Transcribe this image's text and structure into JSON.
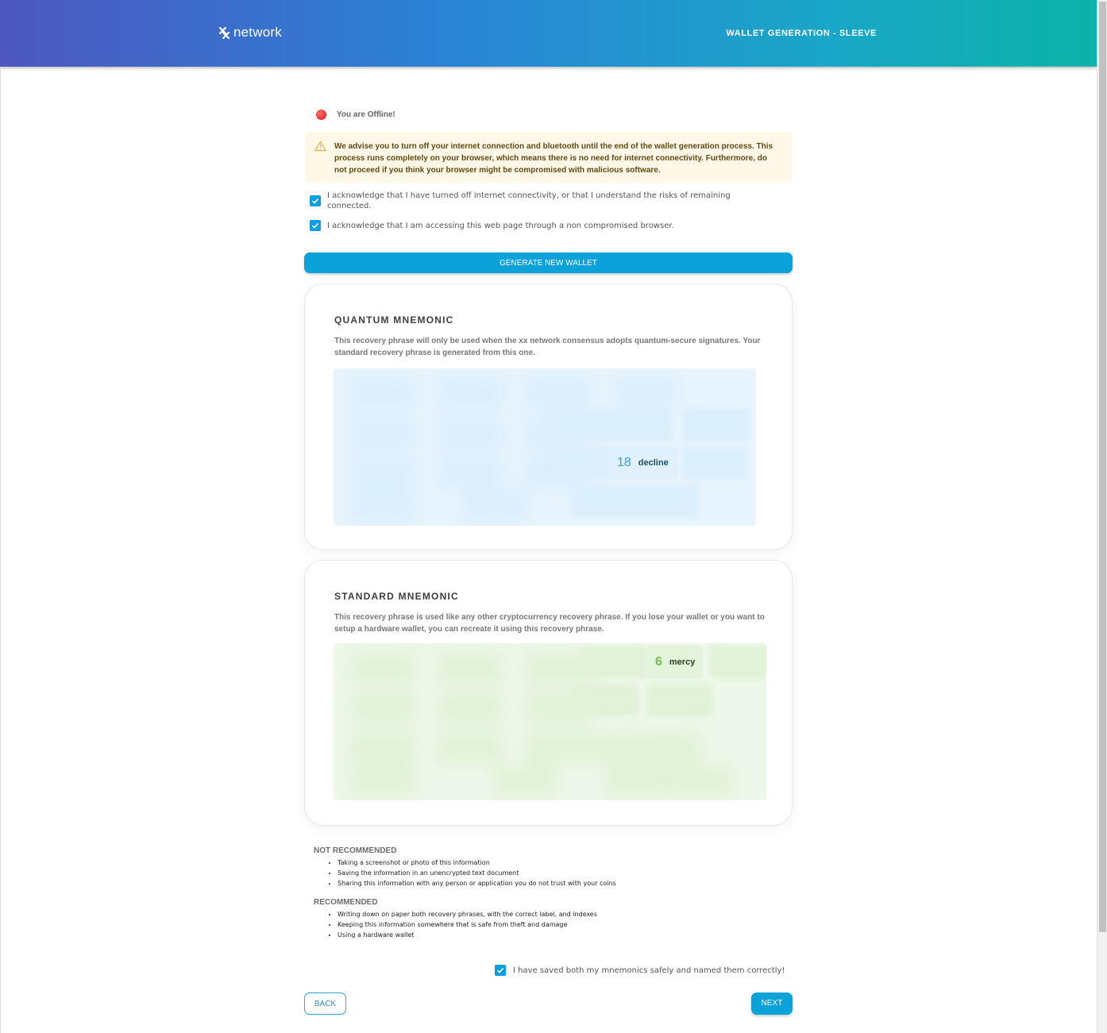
{
  "header": {
    "logo_text": "network",
    "page_title": "WALLET GENERATION - SLEEVE"
  },
  "status": {
    "offline_text": "You are Offline!"
  },
  "warning": {
    "text": "We advise you to turn off your internet connection and bluetooth until the end of the wallet generation process. This process runs completely on your browser, which means there is no need for internet connectivity. Furthermore, do not proceed if you think your browser might be compromised with malicious software."
  },
  "acknowledgements": [
    {
      "label": "I acknowledge that I have turned off internet connectivity, or that I understand the risks of remaining connected.",
      "checked": true
    },
    {
      "label": "I acknowledge that I am accessing this web page through a non compromised browser.",
      "checked": true
    }
  ],
  "generate_button": "GENERATE NEW WALLET",
  "quantum": {
    "title": "QUANTUM MNEMONIC",
    "description": "This recovery phrase will only be used when the xx network consensus adopts quantum-secure signatures. Your standard recovery phrase is generated from this one.",
    "visible_word": {
      "num": "18",
      "word": "decline"
    }
  },
  "standard": {
    "title": "STANDARD MNEMONIC",
    "description": "This recovery phrase is used like any other cryptocurrency recovery phrase. If you lose your wallet or you want to setup a hardware wallet, you can recreate it using this recovery phrase.",
    "visible_word": {
      "num": "6",
      "word": "mercy"
    }
  },
  "not_recommended": {
    "heading": "NOT RECOMMENDED",
    "items": [
      "Taking a screenshot or photo of this information",
      "Saving the information in an unencrypted text document",
      "Sharing this information with any person or application you do not trust with your coins"
    ]
  },
  "recommended": {
    "heading": "RECOMMENDED",
    "items": [
      "Writing down on paper both recovery phrases, with the correct label, and indexes",
      "Keeping this information somewhere that is safe from theft and damage",
      "Using a hardware wallet"
    ]
  },
  "saved_confirmation": {
    "label": "I have saved both my mnemonics safely and named them correctly!",
    "checked": true
  },
  "buttons": {
    "back": "BACK",
    "next": "NEXT"
  },
  "colors": {
    "accent": "#0aa2d8",
    "warning_bg": "#fff8e9",
    "warning_text": "#5f4a12",
    "offline_dot": "#e02424"
  }
}
